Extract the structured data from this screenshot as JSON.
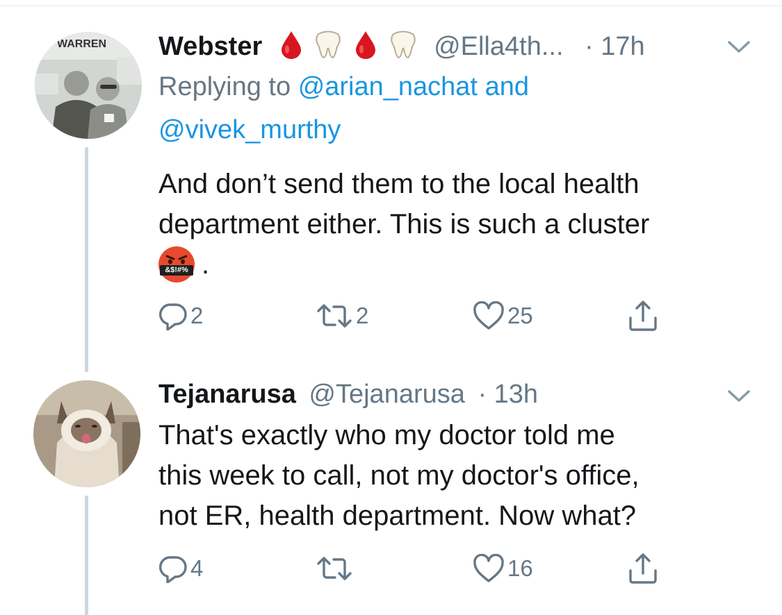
{
  "tweets": [
    {
      "name": "Webster",
      "name_emojis": [
        "blood-drop-icon",
        "tooth-icon",
        "blood-drop-icon",
        "tooth-icon"
      ],
      "handle": "@Ella4th...",
      "time": "· 17h",
      "replying_prefix": "Replying to",
      "reply_to_1": "@arian_nachat",
      "reply_and": "and",
      "reply_to_2": "@vivek_murthy",
      "text_line1": "And don’t send them to the local health",
      "text_line2": "department either.  This is such a cluster",
      "text_emoji_label": "&$!#%",
      "text_end": ".",
      "avatar_sign_text": "WARREN",
      "replies": "2",
      "retweets": "2",
      "likes": "25"
    },
    {
      "name": "Tejanarusa",
      "handle": "@Tejanarusa",
      "time": "· 13h",
      "text_line1": "That's exactly who my doctor told me",
      "text_line2": "this week to call, not my doctor's office,",
      "text_line3": "not ER, health department. Now what?",
      "replies": "4",
      "retweets": "",
      "likes": "16"
    }
  ],
  "colors": {
    "text": "#14171a",
    "muted": "#657786",
    "link": "#1b95e0",
    "thread_line": "#ccd6dd",
    "divider": "#e6ecf0"
  }
}
